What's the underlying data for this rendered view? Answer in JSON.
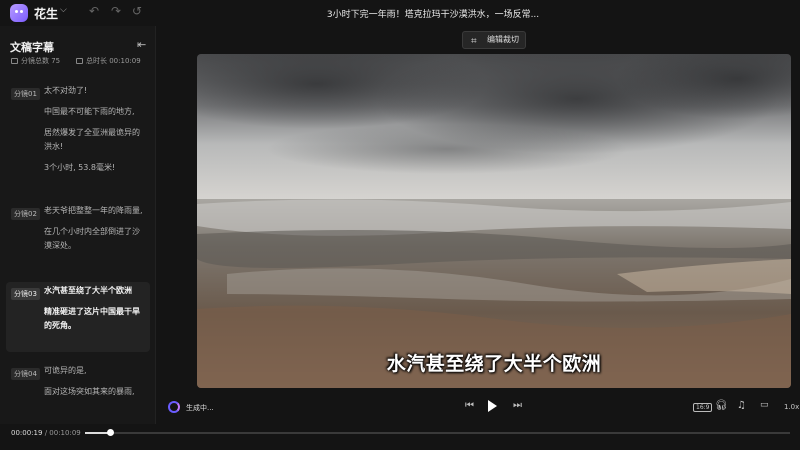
{
  "app": {
    "name": "花生",
    "doc_title": "3小时下完一年雨！塔克拉玛干沙漠洪水，一场反常..."
  },
  "toolbar": {
    "undo_icon": "undo-icon",
    "redo_icon": "redo-icon",
    "history_icon": "history-icon"
  },
  "sidebar": {
    "title": "文稿字幕",
    "segment_count_label": "分镜总数 75",
    "total_duration_label": "总时长 00:10:09",
    "segments": [
      {
        "tag": "分镜01",
        "lines": [
          "太不对劲了!",
          "中国最不可能下雨的地方,",
          "居然爆发了全亚洲最诡异的洪水!",
          "3个小时, 53.8毫米!"
        ]
      },
      {
        "tag": "分镜02",
        "lines": [
          "老天爷把整整一年的降雨量,",
          "在几个小时内全部倒进了沙漠深处。"
        ]
      },
      {
        "tag": "分镜03",
        "active": true,
        "lines": [
          "水汽甚至绕了大半个欧洲",
          "精准砸进了这片中国最干旱的死角。"
        ]
      },
      {
        "tag": "分镜04",
        "lines": [
          "可诡异的是,",
          "面对这场突如其来的暴雨,"
        ]
      }
    ]
  },
  "editor": {
    "crop_button": "编辑裁切",
    "subtitle": "水汽甚至绕了大半个欧洲"
  },
  "player": {
    "status": "生成中...",
    "ratio": "16:9",
    "speed": "1.0x",
    "current_time": "00:00:19",
    "total_time": "00:10:09",
    "progress": 0.035
  },
  "colors": {
    "background": "#141414",
    "accent": "#6a5cff"
  }
}
